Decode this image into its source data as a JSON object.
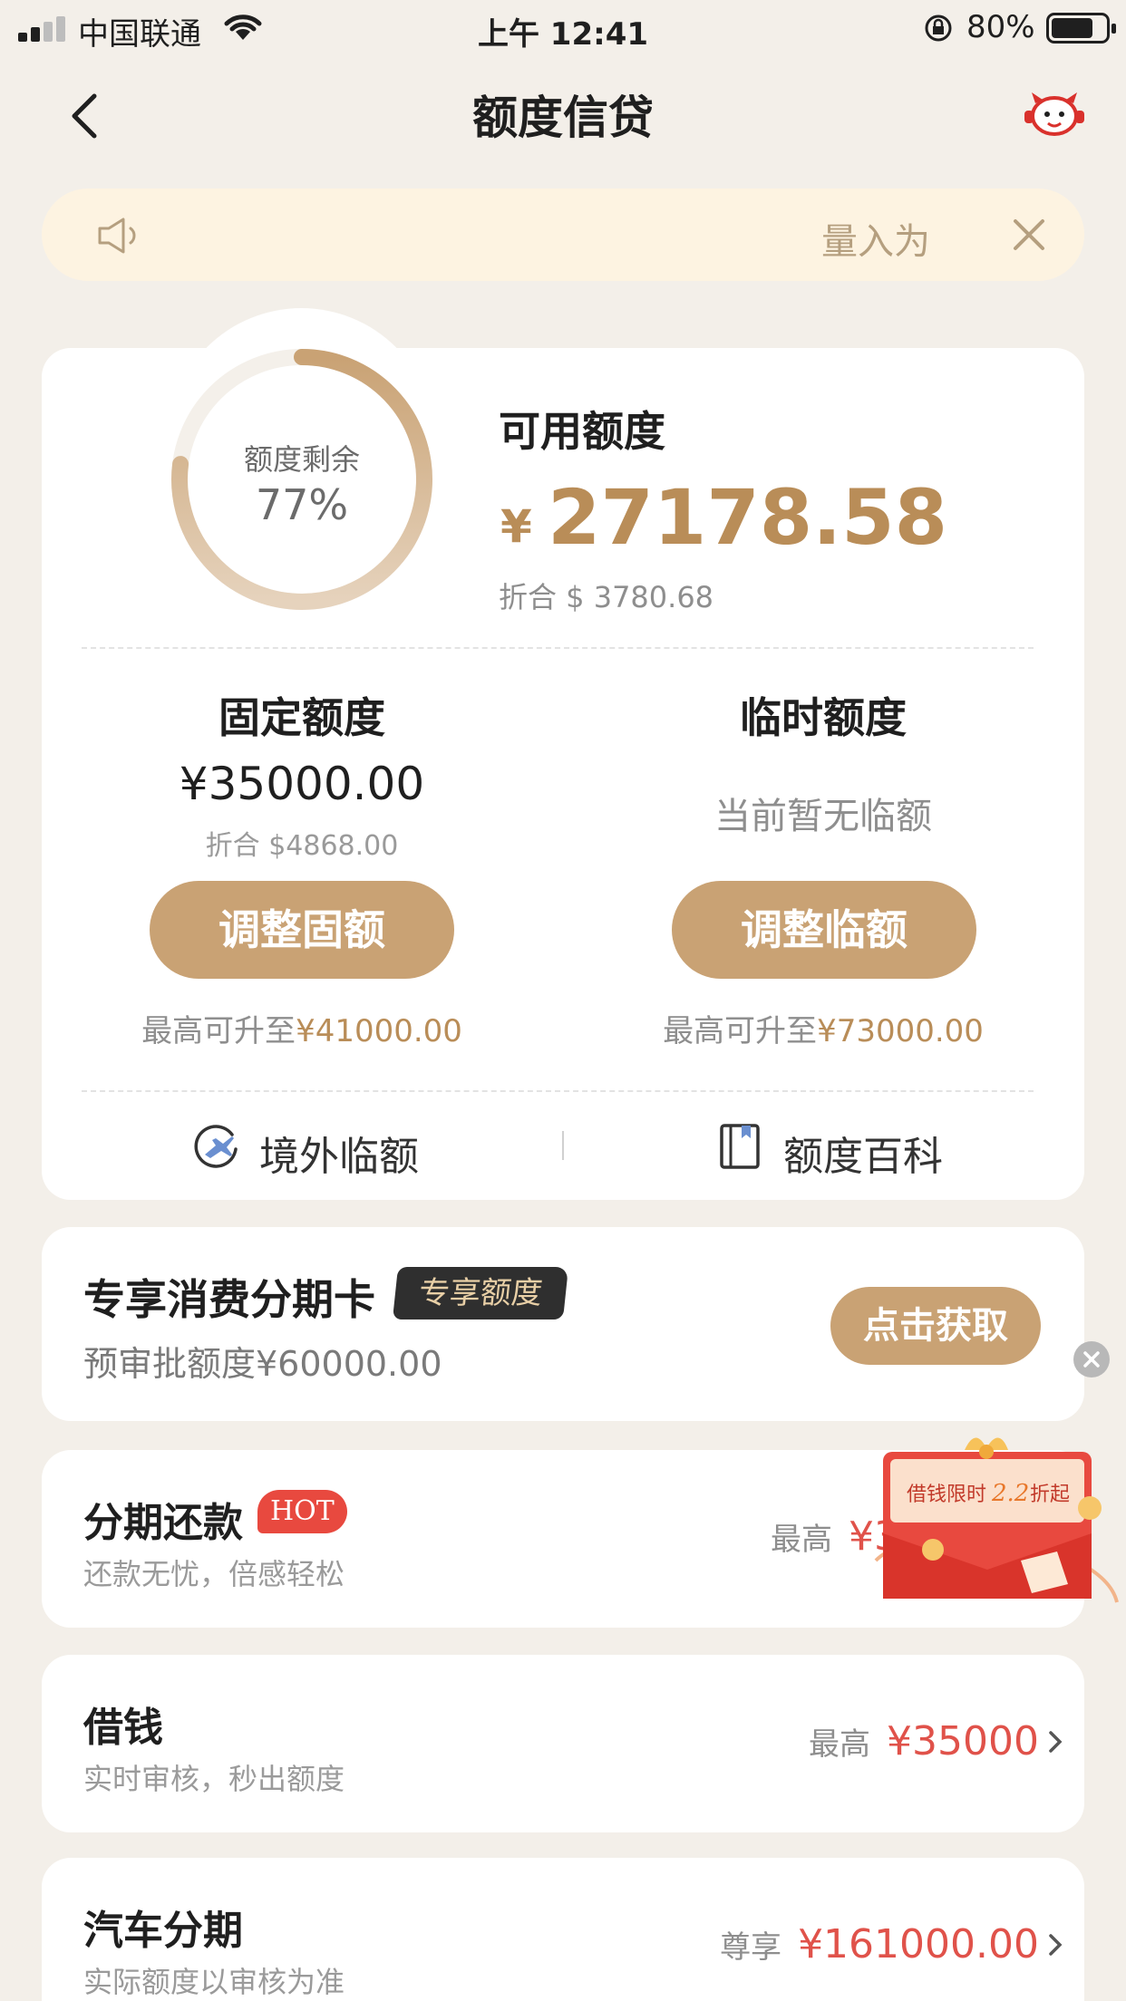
{
  "status_bar": {
    "carrier": "中国联通",
    "time": "上午 12:41",
    "battery": "80%"
  },
  "nav": {
    "title": "额度信贷"
  },
  "notice": {
    "text": "量入为"
  },
  "credit": {
    "ring_label": "额度剩余",
    "ring_percent": "77%",
    "ring_fraction": 0.77,
    "available_label": "可用额度",
    "currency_symbol": "¥",
    "available_amount": "27178.58",
    "available_usd": "折合 $ 3780.68",
    "fixed": {
      "title": "固定额度",
      "amount": "¥35000.00",
      "usd": "折合 $4868.00",
      "button": "调整固额",
      "max_prefix": "最高可升至",
      "max_value": "¥41000.00"
    },
    "temporary": {
      "title": "临时额度",
      "status": "当前暂无临额",
      "button": "调整临额",
      "max_prefix": "最高可升至",
      "max_value": "¥73000.00"
    },
    "links": {
      "overseas": "境外临额",
      "wiki": "额度百科"
    }
  },
  "exclusive_card": {
    "title": "专享消费分期卡",
    "tag": "专享额度",
    "subtitle": "预审批额度¥60000.00",
    "button": "点击获取"
  },
  "rows": [
    {
      "title": "分期还款",
      "tag": "HOT",
      "subtitle": "还款无忧，倍感轻松",
      "prefix": "最高",
      "value": "¥3"
    },
    {
      "title": "借钱",
      "subtitle": "实时审核，秒出额度",
      "prefix": "最高",
      "value": "¥35000"
    },
    {
      "title": "汽车分期",
      "subtitle": "实际额度以审核为准",
      "prefix": "尊享",
      "value": "¥161000.00"
    }
  ],
  "promo": {
    "text_pre": "借钱限时",
    "text_num": "2.2",
    "text_post": "折起"
  },
  "colors": {
    "accent_gold": "#c9a274",
    "amount_gold": "#b98d58",
    "value_red": "#e0524a",
    "background": "#f3efe9",
    "notice_bg": "#fdf3e1"
  }
}
